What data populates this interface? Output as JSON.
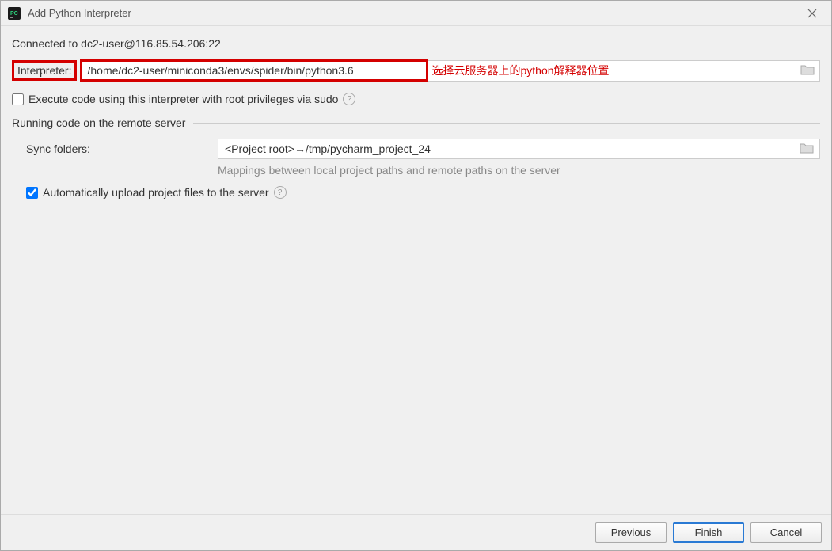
{
  "window": {
    "title": "Add Python Interpreter"
  },
  "connection": {
    "text": "Connected to dc2-user@116.85.54.206:22"
  },
  "interpreter": {
    "label": "Interpreter:",
    "path": "/home/dc2-user/miniconda3/envs/spider/bin/python3.6",
    "annotation": "选择云服务器上的python解释器位置"
  },
  "sudo": {
    "label": "Execute code using this interpreter with root privileges via sudo",
    "checked": false
  },
  "remote_section": {
    "title": "Running code on the remote server"
  },
  "sync": {
    "label": "Sync folders:",
    "value": "<Project root>→/tmp/pycharm_project_24",
    "hint": "Mappings between local project paths and remote paths on the server"
  },
  "auto_upload": {
    "label": "Automatically upload project files to the server",
    "checked": true
  },
  "buttons": {
    "previous": "Previous",
    "finish": "Finish",
    "cancel": "Cancel"
  }
}
